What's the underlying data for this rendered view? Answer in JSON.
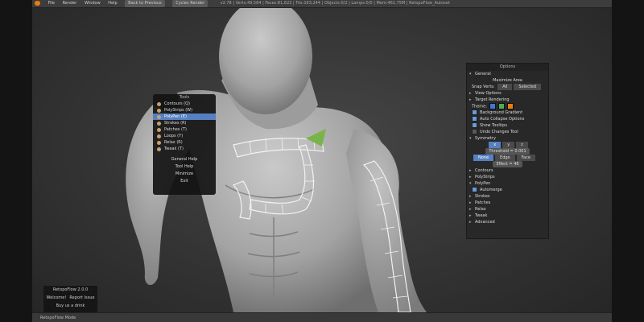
{
  "menubar": {
    "items": [
      "File",
      "Render",
      "Window",
      "Help"
    ],
    "layout": "Back to Previous",
    "engine": "Cycles Render",
    "stats": "v2.78 | Verts:49,584 | Faces:81,622 | Tris:163,244 | Objects:0/2 | Lamps:0/0 | Mem:461.75M | RetopoFlow_Autoset"
  },
  "statusbar": {
    "mode": "RetopoFlow Mode"
  },
  "tools": {
    "title": "Tools",
    "items": [
      {
        "label": "Contours (Q)",
        "selected": false
      },
      {
        "label": "PolyStrips (W)",
        "selected": false
      },
      {
        "label": "PolyPen (E)",
        "selected": true
      },
      {
        "label": "Strokes (R)",
        "selected": false
      },
      {
        "label": "Patches (T)",
        "selected": false
      },
      {
        "label": "Loops (Y)",
        "selected": false
      },
      {
        "label": "Relax (R)",
        "selected": false
      },
      {
        "label": "Tweak (T)",
        "selected": false
      }
    ],
    "buttons": [
      "General Help",
      "Tool Help",
      "Minimize",
      "Exit"
    ]
  },
  "options": {
    "title": "Options",
    "general": "General",
    "maximize": "Maximize Area",
    "snap_label": "Snap Verts:",
    "snap_all": "All",
    "snap_selected": "Selected",
    "view_options": "View Options",
    "target_rendering": "Target Rendering",
    "theme_label": "Theme:",
    "theme_colors": [
      "#3c78d8",
      "#4caf50",
      "#e87d0d"
    ],
    "background_gradient": "Background Gradient",
    "auto_collapse": "Auto Collapse Options",
    "show_tooltips": "Show Tooltips",
    "undo_changes": "Undo Changes Tool",
    "symmetry": "Symmetry",
    "axes": [
      "x",
      "y",
      "z"
    ],
    "threshold": "Threshold = 0.001",
    "sym_modes": [
      "None",
      "Edge",
      "Face"
    ],
    "effect": "Effect = 46",
    "contours": "Contours",
    "polystrips": "PolyStrips",
    "polypen": "PolyPen",
    "automerge": "Automerge",
    "strokes": "Strokes",
    "patches": "Patches",
    "relax": "Relax",
    "tweak": "Tweak",
    "advanced": "Advanced"
  },
  "welcome": {
    "title": "RetopoFlow 2.0.0",
    "welcome": "Welcome!",
    "report": "Report Issue",
    "buy": "Buy us a drink"
  }
}
